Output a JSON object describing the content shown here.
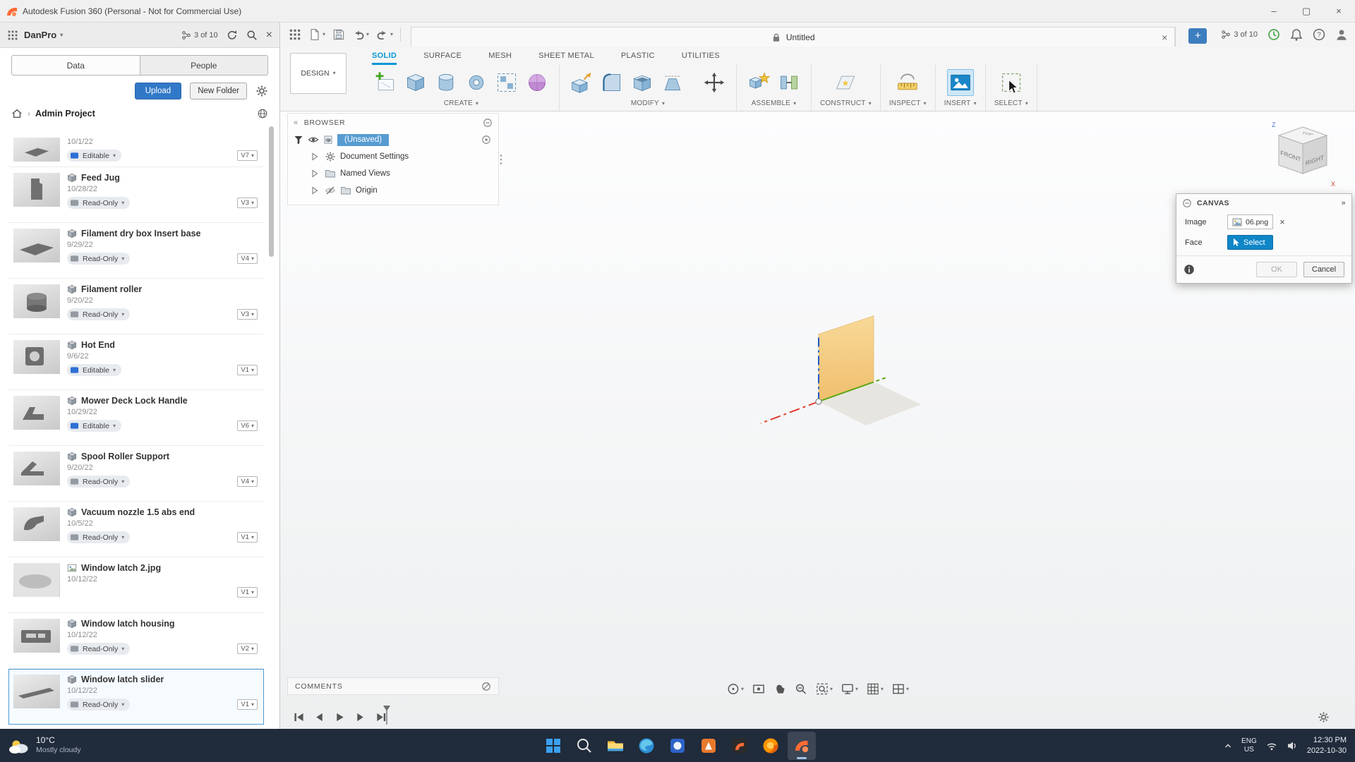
{
  "titlebar": {
    "title": "Autodesk Fusion 360 (Personal - Not for Commercial Use)"
  },
  "data_panel": {
    "workspace": "DanPro",
    "version_counter": "3 of 10",
    "tabs": [
      {
        "label": "Data",
        "active": true
      },
      {
        "label": "People",
        "active": false
      }
    ],
    "upload_label": "Upload",
    "new_folder_label": "New Folder",
    "breadcrumb": "Admin Project",
    "items": [
      {
        "name": "",
        "date": "10/1/22",
        "status": "Editable",
        "version": "V7",
        "thumb": "plate",
        "partial": true
      },
      {
        "name": "Feed Jug",
        "date": "10/28/22",
        "status": "Read-Only",
        "version": "V3",
        "thumb": "jug"
      },
      {
        "name": "Filament dry box Insert base",
        "date": "9/29/22",
        "status": "Read-Only",
        "version": "V4",
        "thumb": "plate"
      },
      {
        "name": "Filament roller",
        "date": "9/20/22",
        "status": "Read-Only",
        "version": "V3",
        "thumb": "cylinder"
      },
      {
        "name": "Hot End",
        "date": "9/6/22",
        "status": "Editable",
        "version": "V1",
        "thumb": "block"
      },
      {
        "name": "Mower Deck Lock Handle",
        "date": "10/29/22",
        "status": "Editable",
        "version": "V6",
        "thumb": "handle"
      },
      {
        "name": "Spool Roller Support",
        "date": "9/20/22",
        "status": "Read-Only",
        "version": "V4",
        "thumb": "bracket"
      },
      {
        "name": "Vacuum nozzle 1.5 abs end",
        "date": "10/5/22",
        "status": "Read-Only",
        "version": "V1",
        "thumb": "nozzle"
      },
      {
        "name": "Window latch 2.jpg",
        "date": "10/12/22",
        "status": null,
        "version": "V1",
        "thumb": "photo",
        "type": "image"
      },
      {
        "name": "Window latch housing",
        "date": "10/12/22",
        "status": "Read-Only",
        "version": "V2",
        "thumb": "plate2"
      },
      {
        "name": "Window latch slider",
        "date": "10/12/22",
        "status": "Read-Only",
        "version": "V1",
        "thumb": "bar",
        "selected": true
      }
    ]
  },
  "appbar": {
    "doc_tab": "Untitled",
    "version_counter": "3 of 10"
  },
  "ribbon": {
    "design_label": "DESIGN",
    "tabs": [
      {
        "label": "SOLID",
        "active": true
      },
      {
        "label": "SURFACE"
      },
      {
        "label": "MESH"
      },
      {
        "label": "SHEET METAL"
      },
      {
        "label": "PLASTIC"
      },
      {
        "label": "UTILITIES"
      }
    ],
    "groups": [
      {
        "label": "CREATE",
        "tools": [
          {
            "name": "create-sketch"
          },
          {
            "name": "box"
          },
          {
            "name": "cylinder"
          },
          {
            "name": "revolve"
          },
          {
            "name": "pattern"
          },
          {
            "name": "form"
          }
        ]
      },
      {
        "label": "MODIFY",
        "tools": [
          {
            "name": "press-pull"
          },
          {
            "name": "fillet"
          },
          {
            "name": "shell"
          },
          {
            "name": "draft"
          },
          {
            "name": "move",
            "spaced": true
          }
        ]
      },
      {
        "label": "ASSEMBLE",
        "tools": [
          {
            "name": "new-component"
          },
          {
            "name": "joint"
          }
        ]
      },
      {
        "label": "CONSTRUCT",
        "tools": [
          {
            "name": "construction-plane"
          }
        ]
      },
      {
        "label": "INSPECT",
        "tools": [
          {
            "name": "measure"
          }
        ]
      },
      {
        "label": "INSERT",
        "tools": [
          {
            "name": "insert-canvas",
            "active": true
          }
        ]
      },
      {
        "label": "SELECT",
        "tools": [
          {
            "name": "select",
            "cursor": true
          }
        ]
      }
    ]
  },
  "browser": {
    "title": "BROWSER",
    "root_label": "(Unsaved)",
    "nodes": [
      {
        "label": "Document Settings",
        "icon": "gear-small"
      },
      {
        "label": "Named Views",
        "icon": "folder"
      },
      {
        "label": "Origin",
        "icon": "folder",
        "hidden": true
      }
    ]
  },
  "canvas_dialog": {
    "title": "CANVAS",
    "image_label": "Image",
    "image_value": "06.png",
    "face_label": "Face",
    "select_label": "Select",
    "ok_label": "OK",
    "cancel_label": "Cancel"
  },
  "comments_label": "COMMENTS",
  "viewcube": {
    "front": "FRONT",
    "right": "RIGHT",
    "top": "TOP",
    "axis_x": "X",
    "axis_z": "Z"
  },
  "navbar": [
    {
      "name": "orbit",
      "caret": true
    },
    {
      "name": "look-at"
    },
    {
      "name": "pan"
    },
    {
      "name": "zoom"
    },
    {
      "name": "fit",
      "caret": true
    },
    {
      "name": "display-settings",
      "caret": true
    },
    {
      "name": "grid-settings",
      "caret": true
    },
    {
      "name": "viewports",
      "caret": true
    }
  ],
  "timeline": [
    {
      "name": "go-to-start"
    },
    {
      "name": "step-back"
    },
    {
      "name": "play"
    },
    {
      "name": "step-forward"
    },
    {
      "name": "go-to-end"
    }
  ],
  "taskbar": {
    "weather_temp": "10°C",
    "weather_desc": "Mostly cloudy",
    "apps": [
      {
        "name": "start"
      },
      {
        "name": "search"
      },
      {
        "name": "file-explorer"
      },
      {
        "name": "edge"
      },
      {
        "name": "app-blue"
      },
      {
        "name": "app-orange"
      },
      {
        "name": "fusion-tile"
      },
      {
        "name": "firefox"
      },
      {
        "name": "fusion-360",
        "active": true
      }
    ],
    "tray": {
      "lang_line1": "ENG",
      "lang_line2": "US",
      "time": "12:30 PM",
      "date": "2022-10-30"
    }
  }
}
